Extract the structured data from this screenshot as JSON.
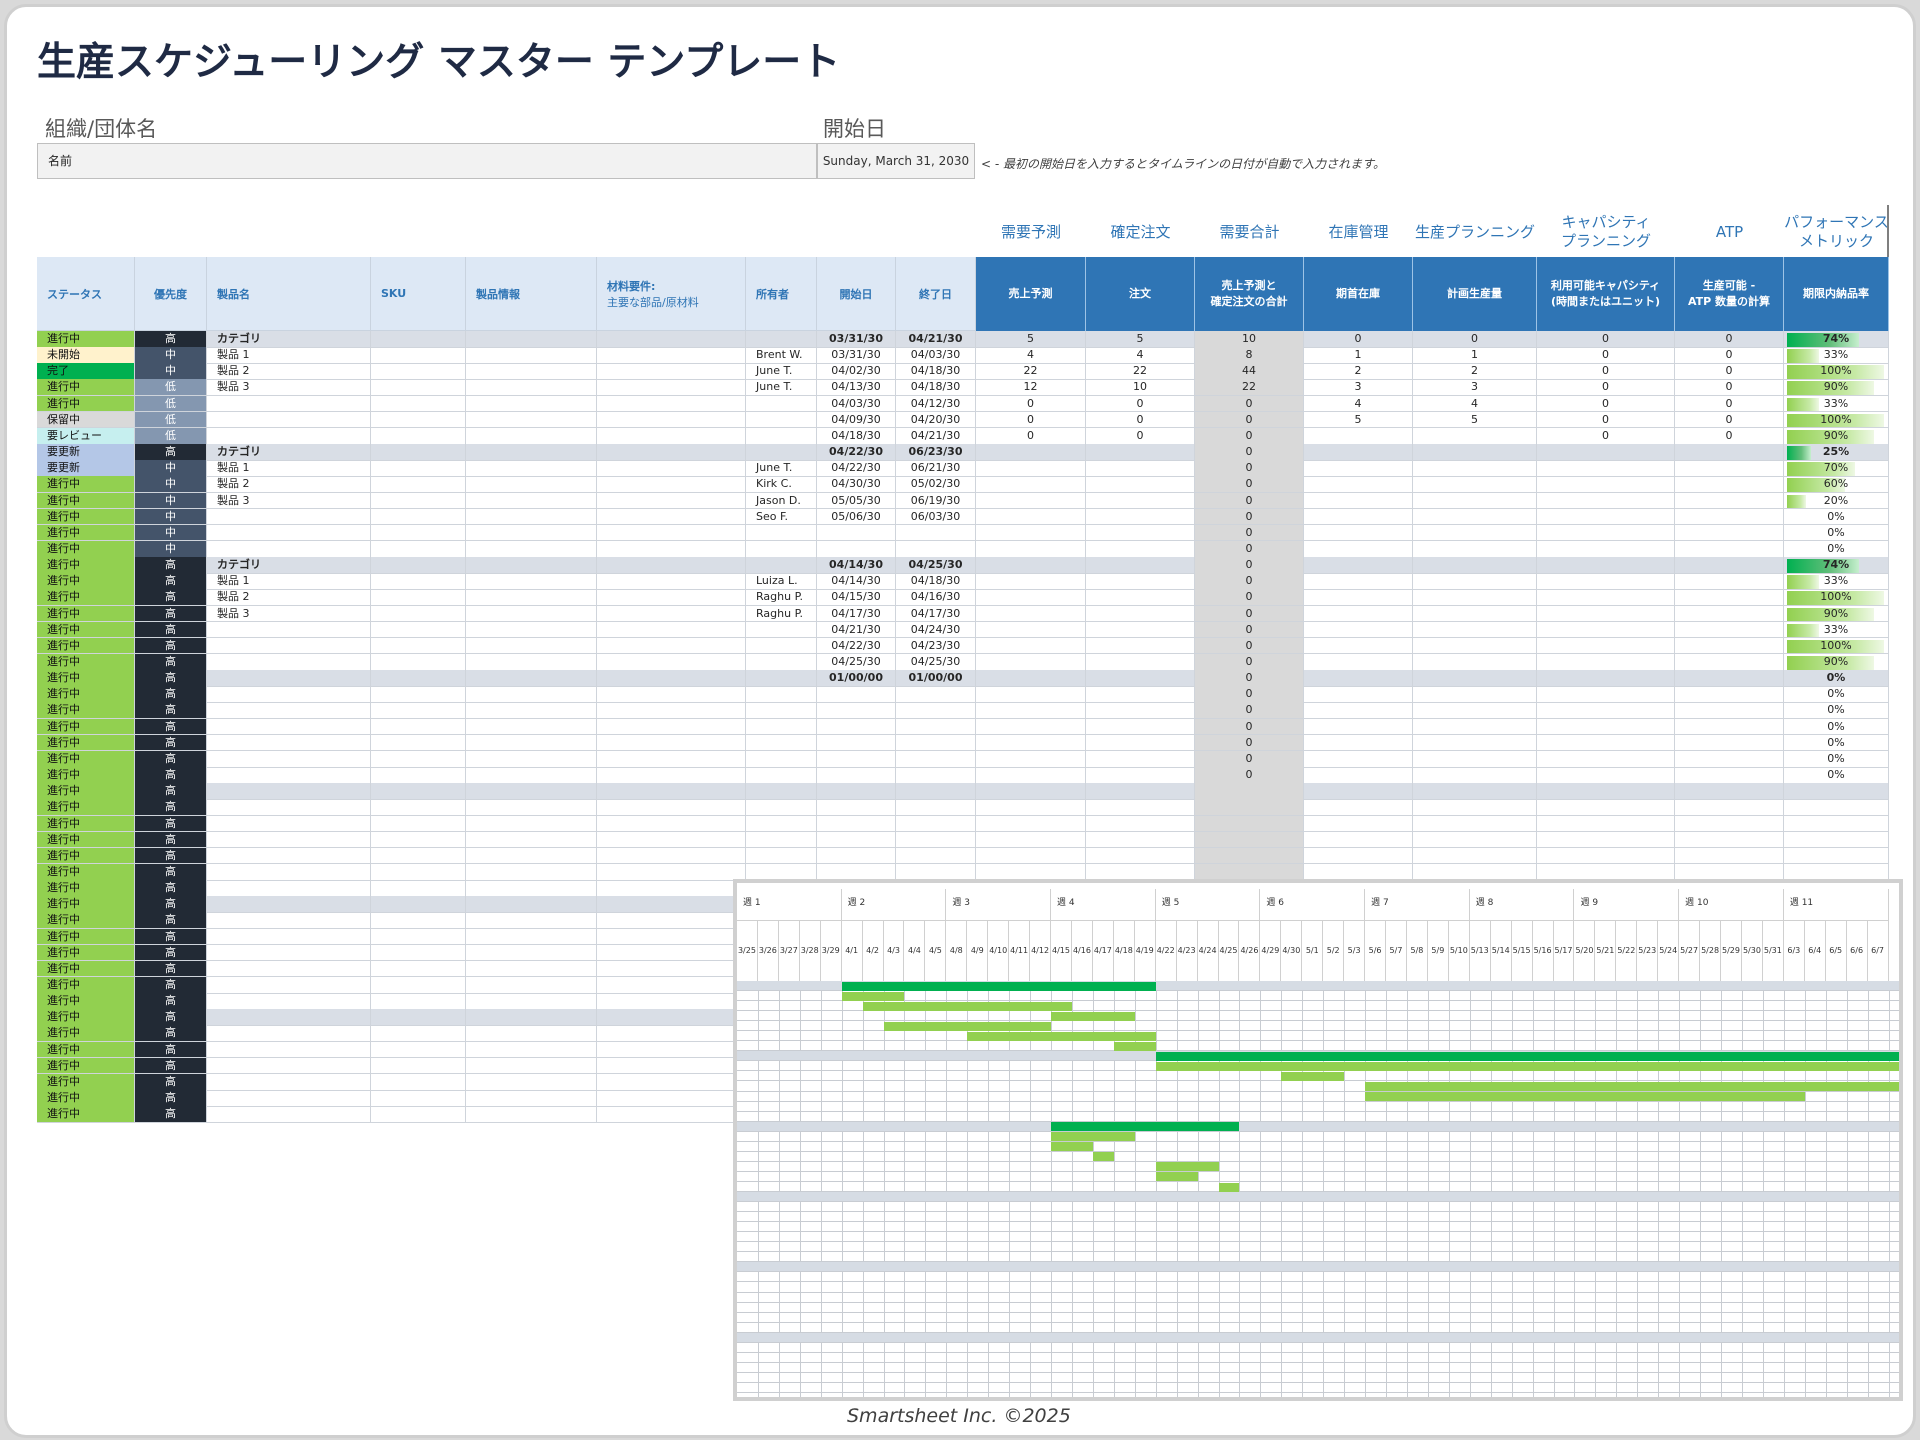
{
  "title": "生産スケジューリング マスター テンプレート",
  "org_label": "組織/団体名",
  "start_label": "開始日",
  "org_value": "名前",
  "start_value": "Sunday, March 31, 2030",
  "hint": "< -  最初の開始日を入力するとタイムラインの日付が自動で入力されます。",
  "group_headers": [
    "需要予測",
    "確定注文",
    "需要合計",
    "在庫管理",
    "生産プランニング",
    "キャパシティ\nプランニング",
    "ATP",
    "パフォーマンス\nメトリック"
  ],
  "columns": [
    {
      "main": "ステータス",
      "sub": ""
    },
    {
      "main": "優先度",
      "sub": ""
    },
    {
      "main": "製品名",
      "sub": ""
    },
    {
      "main": "SKU",
      "sub": ""
    },
    {
      "main": "製品情報",
      "sub": ""
    },
    {
      "main": "材料要件:",
      "sub": "主要な部品/原材料"
    },
    {
      "main": "所有者",
      "sub": ""
    },
    {
      "main": "開始日",
      "sub": ""
    },
    {
      "main": "終了日",
      "sub": ""
    },
    {
      "main": "売上予測",
      "sub": ""
    },
    {
      "main": "注文",
      "sub": ""
    },
    {
      "main": "売上予測と\n確定注文の合計",
      "sub": ""
    },
    {
      "main": "期首在庫",
      "sub": ""
    },
    {
      "main": "計画生産量",
      "sub": ""
    },
    {
      "main": "利用可能キャパシティ\n(時間またはユニット)",
      "sub": ""
    },
    {
      "main": "生産可能 -\nATP 数量の計算",
      "sub": ""
    },
    {
      "main": "期限内納品率",
      "sub": ""
    }
  ],
  "status_colors": {
    "進行中": "#92d050",
    "未開始": "#fff2cc",
    "完了": "#00b050",
    "保留中": "#d9d9d9",
    "要レビュー": "#c6efef",
    "要更新": "#b4c7e7"
  },
  "priority_colors": {
    "高": "#222a35",
    "中": "#44546a",
    "低": "#8497b0"
  },
  "rows": [
    {
      "type": "cat",
      "status": "進行中",
      "priority": "高",
      "name": "カテゴリ",
      "start": "03/31/30",
      "end": "04/21/30",
      "forecast": "5",
      "orders": "5",
      "total": "10",
      "inventory": "0",
      "planned": "0",
      "capacity": "0",
      "atp": "0",
      "perf": "74%",
      "pct": 74
    },
    {
      "status": "未開始",
      "priority": "中",
      "name": "製品 1",
      "owner": "Brent W.",
      "start": "03/31/30",
      "end": "04/03/30",
      "forecast": "4",
      "orders": "4",
      "total": "8",
      "inventory": "1",
      "planned": "1",
      "capacity": "0",
      "atp": "0",
      "perf": "33%",
      "pct": 33
    },
    {
      "status": "完了",
      "priority": "中",
      "name": "製品 2",
      "owner": "June T.",
      "start": "04/02/30",
      "end": "04/18/30",
      "forecast": "22",
      "orders": "22",
      "total": "44",
      "inventory": "2",
      "planned": "2",
      "capacity": "0",
      "atp": "0",
      "perf": "100%",
      "pct": 100
    },
    {
      "status": "進行中",
      "priority": "低",
      "name": "製品 3",
      "owner": "June T.",
      "start": "04/13/30",
      "end": "04/18/30",
      "forecast": "12",
      "orders": "10",
      "total": "22",
      "inventory": "3",
      "planned": "3",
      "capacity": "0",
      "atp": "0",
      "perf": "90%",
      "pct": 90
    },
    {
      "status": "進行中",
      "priority": "低",
      "start": "04/03/30",
      "end": "04/12/30",
      "forecast": "0",
      "orders": "0",
      "total": "0",
      "inventory": "4",
      "planned": "4",
      "capacity": "0",
      "atp": "0",
      "perf": "33%",
      "pct": 33
    },
    {
      "status": "保留中",
      "priority": "低",
      "start": "04/09/30",
      "end": "04/20/30",
      "forecast": "0",
      "orders": "0",
      "total": "0",
      "inventory": "5",
      "planned": "5",
      "capacity": "0",
      "atp": "0",
      "perf": "100%",
      "pct": 100
    },
    {
      "status": "要レビュー",
      "priority": "低",
      "start": "04/18/30",
      "end": "04/21/30",
      "forecast": "0",
      "orders": "0",
      "total": "0",
      "capacity": "0",
      "atp": "0",
      "perf": "90%",
      "pct": 90
    },
    {
      "type": "cat",
      "status": "要更新",
      "priority": "高",
      "name": "カテゴリ",
      "start": "04/22/30",
      "end": "06/23/30",
      "total": "0",
      "perf": "25%",
      "pct": 25
    },
    {
      "status": "要更新",
      "priority": "中",
      "name": "製品 1",
      "owner": "June T.",
      "start": "04/22/30",
      "end": "06/21/30",
      "total": "0",
      "perf": "70%",
      "pct": 70
    },
    {
      "status": "進行中",
      "priority": "中",
      "name": "製品 2",
      "owner": "Kirk C.",
      "start": "04/30/30",
      "end": "05/02/30",
      "total": "0",
      "perf": "60%",
      "pct": 60
    },
    {
      "status": "進行中",
      "priority": "中",
      "name": "製品 3",
      "owner": "Jason D.",
      "start": "05/05/30",
      "end": "06/19/30",
      "total": "0",
      "perf": "20%",
      "pct": 20
    },
    {
      "status": "進行中",
      "priority": "中",
      "owner": "Seo F.",
      "start": "05/06/30",
      "end": "06/03/30",
      "total": "0",
      "perf": "0%",
      "pct": 0
    },
    {
      "status": "進行中",
      "priority": "中",
      "total": "0",
      "perf": "0%",
      "pct": 0
    },
    {
      "status": "進行中",
      "priority": "中",
      "total": "0",
      "perf": "0%",
      "pct": 0
    },
    {
      "type": "cat",
      "status": "進行中",
      "priority": "高",
      "name": "カテゴリ",
      "start": "04/14/30",
      "end": "04/25/30",
      "total": "0",
      "perf": "74%",
      "pct": 74
    },
    {
      "status": "進行中",
      "priority": "高",
      "name": "製品 1",
      "owner": "Luiza L.",
      "start": "04/14/30",
      "end": "04/18/30",
      "total": "0",
      "perf": "33%",
      "pct": 33
    },
    {
      "status": "進行中",
      "priority": "高",
      "name": "製品 2",
      "owner": "Raghu P.",
      "start": "04/15/30",
      "end": "04/16/30",
      "total": "0",
      "perf": "100%",
      "pct": 100
    },
    {
      "status": "進行中",
      "priority": "高",
      "name": "製品 3",
      "owner": "Raghu P.",
      "start": "04/17/30",
      "end": "04/17/30",
      "total": "0",
      "perf": "90%",
      "pct": 90
    },
    {
      "status": "進行中",
      "priority": "高",
      "start": "04/21/30",
      "end": "04/24/30",
      "total": "0",
      "perf": "33%",
      "pct": 33
    },
    {
      "status": "進行中",
      "priority": "高",
      "start": "04/22/30",
      "end": "04/23/30",
      "total": "0",
      "perf": "100%",
      "pct": 100
    },
    {
      "status": "進行中",
      "priority": "高",
      "start": "04/25/30",
      "end": "04/25/30",
      "total": "0",
      "perf": "90%",
      "pct": 90
    },
    {
      "type": "cat",
      "status": "進行中",
      "priority": "高",
      "start": "01/00/00",
      "end": "01/00/00",
      "total": "0",
      "perf": "0%",
      "pct": 0
    },
    {
      "status": "進行中",
      "priority": "高",
      "total": "0",
      "perf": "0%",
      "pct": 0
    },
    {
      "status": "進行中",
      "priority": "高",
      "total": "0",
      "perf": "0%",
      "pct": 0
    },
    {
      "status": "進行中",
      "priority": "高",
      "total": "0",
      "perf": "0%",
      "pct": 0
    },
    {
      "status": "進行中",
      "priority": "高",
      "total": "0",
      "perf": "0%",
      "pct": 0
    },
    {
      "status": "進行中",
      "priority": "高",
      "total": "0",
      "perf": "0%",
      "pct": 0
    },
    {
      "status": "進行中",
      "priority": "高",
      "total": "0",
      "perf": "0%",
      "pct": 0
    },
    {
      "type": "cat",
      "status": "進行中",
      "priority": "高"
    },
    {
      "status": "進行中",
      "priority": "高"
    },
    {
      "status": "進行中",
      "priority": "高"
    },
    {
      "status": "進行中",
      "priority": "高"
    },
    {
      "status": "進行中",
      "priority": "高"
    },
    {
      "status": "進行中",
      "priority": "高"
    },
    {
      "status": "進行中",
      "priority": "高"
    },
    {
      "type": "cat",
      "status": "進行中",
      "priority": "高"
    },
    {
      "status": "進行中",
      "priority": "高"
    },
    {
      "status": "進行中",
      "priority": "高"
    },
    {
      "status": "進行中",
      "priority": "高"
    },
    {
      "status": "進行中",
      "priority": "高"
    },
    {
      "status": "進行中",
      "priority": "高"
    },
    {
      "status": "進行中",
      "priority": "高"
    },
    {
      "type": "cat",
      "status": "進行中",
      "priority": "高"
    },
    {
      "status": "進行中",
      "priority": "高"
    },
    {
      "status": "進行中",
      "priority": "高"
    },
    {
      "status": "進行中",
      "priority": "高"
    },
    {
      "status": "進行中",
      "priority": "高"
    },
    {
      "status": "進行中",
      "priority": "高"
    },
    {
      "status": "進行中",
      "priority": "高"
    }
  ],
  "gantt": {
    "weeks": [
      "週 1",
      "週 2",
      "週 3",
      "週 4",
      "週 5",
      "週 6",
      "週 7",
      "週 8",
      "週 9",
      "週 10",
      "週 11"
    ],
    "days": [
      "3/25",
      "3/26",
      "3/27",
      "3/28",
      "3/29",
      "4/1",
      "4/2",
      "4/3",
      "4/4",
      "4/5",
      "4/8",
      "4/9",
      "4/10",
      "4/11",
      "4/12",
      "4/15",
      "4/16",
      "4/17",
      "4/18",
      "4/19",
      "4/22",
      "4/23",
      "4/24",
      "4/25",
      "4/26",
      "4/29",
      "4/30",
      "5/1",
      "5/2",
      "5/3",
      "5/6",
      "5/7",
      "5/8",
      "5/9",
      "5/10",
      "5/13",
      "5/14",
      "5/15",
      "5/16",
      "5/17",
      "5/20",
      "5/21",
      "5/22",
      "5/23",
      "5/24",
      "5/27",
      "5/28",
      "5/29",
      "5/30",
      "5/31",
      "6/3",
      "6/4",
      "6/5",
      "6/6",
      "6/7"
    ],
    "shaded_rows": [
      0,
      7,
      14,
      21,
      28,
      35
    ],
    "row_count": 42,
    "bars": [
      {
        "row": 0,
        "start": 5,
        "end": 19,
        "cat": true
      },
      {
        "row": 1,
        "start": 5,
        "end": 7
      },
      {
        "row": 2,
        "start": 6,
        "end": 15
      },
      {
        "row": 3,
        "start": 15,
        "end": 18
      },
      {
        "row": 4,
        "start": 7,
        "end": 14
      },
      {
        "row": 5,
        "start": 11,
        "end": 19
      },
      {
        "row": 6,
        "start": 18,
        "end": 19
      },
      {
        "row": 7,
        "start": 20,
        "end": 55,
        "cat": true
      },
      {
        "row": 8,
        "start": 20,
        "end": 55
      },
      {
        "row": 9,
        "start": 26,
        "end": 28
      },
      {
        "row": 10,
        "start": 30,
        "end": 55
      },
      {
        "row": 11,
        "start": 30,
        "end": 50
      },
      {
        "row": 14,
        "start": 15,
        "end": 23,
        "cat": true
      },
      {
        "row": 15,
        "start": 15,
        "end": 18
      },
      {
        "row": 16,
        "start": 15,
        "end": 16
      },
      {
        "row": 17,
        "start": 17,
        "end": 17
      },
      {
        "row": 18,
        "start": 20,
        "end": 22
      },
      {
        "row": 19,
        "start": 20,
        "end": 21
      },
      {
        "row": 20,
        "start": 23,
        "end": 23
      }
    ]
  },
  "footer": "Smartsheet Inc. ©2025"
}
